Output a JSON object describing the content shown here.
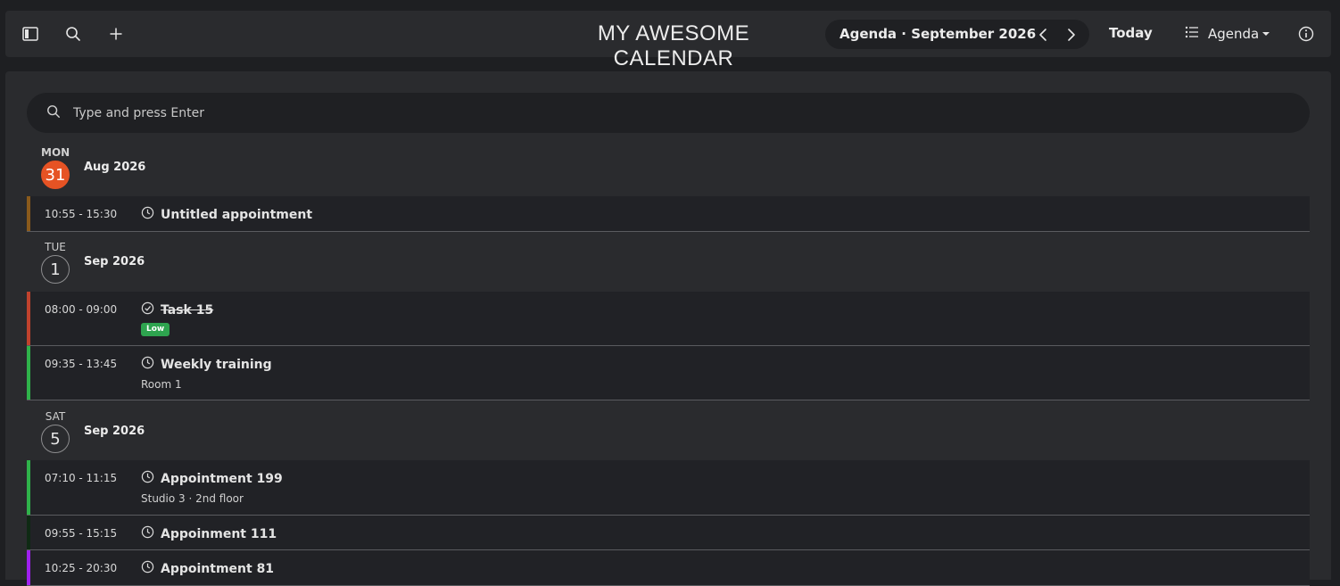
{
  "colors": {
    "today_accent": "#e65324",
    "badge_low": "#2ea44f",
    "bar_brown": "#8a5a1c",
    "bar_red": "#c0422d",
    "bar_green": "#2fb34a",
    "bar_darkgreen": "#0f2a14",
    "bar_purple": "#a020f0"
  },
  "toolbar": {
    "sidebar_icon": "sidebar-toggle-icon",
    "search_icon": "search-icon",
    "add_icon": "plus-icon",
    "app_title": "MY AWESOME CALENDAR",
    "period_label": "Agenda · September 2026",
    "prev_icon": "chevron-left-icon",
    "next_icon": "chevron-right-icon",
    "today_label": "Today",
    "view_label": "Agenda",
    "info_icon": "info-icon"
  },
  "search": {
    "placeholder": "Type and press Enter"
  },
  "days": [
    {
      "dow": "MON",
      "date": "31",
      "month": "Aug 2026",
      "is_today": true
    },
    {
      "dow": "TUE",
      "date": "1",
      "month": "Sep 2026",
      "is_today": false
    },
    {
      "dow": "SAT",
      "date": "5",
      "month": "Sep 2026",
      "is_today": false
    }
  ],
  "events": [
    {
      "time": "10:55 - 15:30",
      "title": "Untitled appointment",
      "kind": "appointment",
      "bar": "#8a5a1c"
    },
    {
      "time": "08:00 - 09:00",
      "title": "Task 15",
      "kind": "task",
      "done": true,
      "badge": "Low",
      "bar": "#c0422d"
    },
    {
      "time": "09:35 - 13:45",
      "title": "Weekly training",
      "kind": "appointment",
      "location": "Room 1",
      "bar": "#2fb34a"
    },
    {
      "time": "07:10 - 11:15",
      "title": "Appointment 199",
      "kind": "appointment",
      "location": "Studio 3 · 2nd floor",
      "bar": "#2fb34a"
    },
    {
      "time": "09:55 - 15:15",
      "title": "Appoinment 111",
      "kind": "appointment",
      "bar": "#0f2a14"
    },
    {
      "time": "10:25 - 20:30",
      "title": "Appointment 81",
      "kind": "appointment",
      "bar": "#a020f0"
    }
  ]
}
